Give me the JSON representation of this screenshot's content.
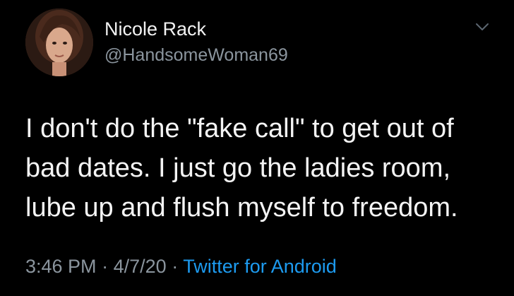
{
  "author": {
    "display_name": "Nicole Rack",
    "handle": "@HandsomeWoman69",
    "avatar_icon": "profile-photo"
  },
  "tweet": {
    "lines": [
      "I don't do the \"fake call\" to get out of",
      "bad dates. I just go the ladies room,",
      "lube up and flush myself to freedom."
    ]
  },
  "meta": {
    "time": "3:46 PM",
    "separator": "·",
    "date": "4/7/20",
    "source": "Twitter for Android"
  },
  "menu_icon": "chevron-down-icon",
  "colors": {
    "background": "#000000",
    "text": "#f4f4f4",
    "muted": "#8b959e",
    "link": "#1d9bf0"
  }
}
